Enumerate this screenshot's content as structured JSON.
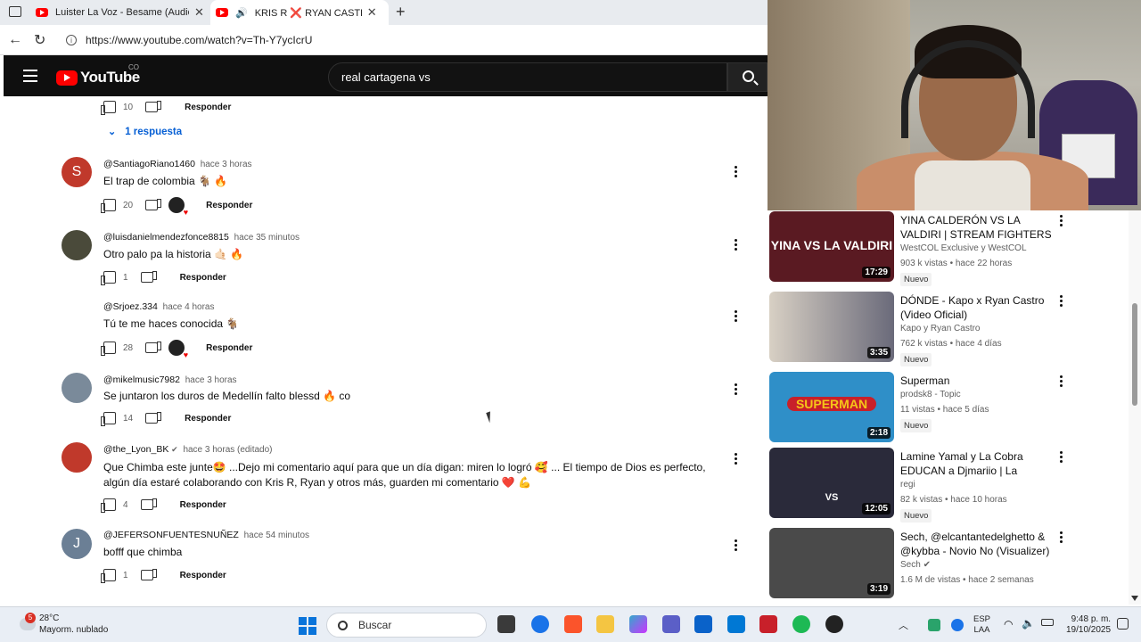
{
  "browser": {
    "tabs": [
      {
        "label": "Luister La Voz - Besame (Audio) |",
        "active": false
      },
      {
        "label": "KRIS R ❌ RYAN CASTRO - M",
        "active": true
      }
    ],
    "url": "https://www.youtube.com/watch?v=Th-Y7ycIcrU"
  },
  "youtube": {
    "logo_text": "YouTube",
    "country_code": "CO",
    "search_value": "real cartagena vs"
  },
  "comments": [
    {
      "id": "top-actions",
      "likes": "10",
      "reply_label": "Responder"
    },
    {
      "handle": "@SantiagoRiano1460",
      "time": "hace 3 horas",
      "text": "El trap de colombia 🐐 🔥",
      "likes": "20",
      "reply_label": "Responder",
      "avatar_letter": "S",
      "avatar_color": "#c0392b",
      "heart": true
    },
    {
      "handle": "@luisdanielmendezfonce8815",
      "time": "hace 35 minutos",
      "text": "Otro palo pa la historia 🤙🏻 🔥",
      "likes": "1",
      "reply_label": "Responder",
      "avatar_color": "#555",
      "heart": false
    },
    {
      "handle": "@Srjoez.334",
      "time": "hace 4 horas",
      "text": "Tú te me haces conocida 🐐",
      "likes": "28",
      "reply_label": "Responder",
      "heart": true
    },
    {
      "handle": "@mikelmusic7982",
      "time": "hace 3 horas",
      "text": "Se juntaron los duros de Medellín falto blessd 🔥 co",
      "likes": "14",
      "reply_label": "Responder",
      "avatar_color": "#7a8a9a",
      "heart": false
    },
    {
      "handle": "@the_Lyon_BK",
      "verified": "✔",
      "time": "hace 3 horas (editado)",
      "text": "Que Chimba este junte🤩 ...Dejo mi comentario aquí para que un día digan: miren lo logró 🥰 ... El tiempo de Dios es perfecto, algún día estaré colaborando con Kris R, Ryan y otros más, guarden mi comentario ❤️ 💪",
      "likes": "4",
      "reply_label": "Responder",
      "avatar_color": "#c0392b",
      "heart": false
    },
    {
      "handle": "@JEFERSONFUENTESNUÑEZ",
      "time": "hace 54 minutos",
      "text": "bofff que chimba",
      "likes": "1",
      "reply_label": "Responder",
      "avatar_letter": "J",
      "avatar_color": "#6b7f95",
      "heart": false
    }
  ],
  "replies_toggle": "1 respuesta",
  "recommendations": [
    {
      "title": "YINA CALDERÓN VS LA VALDIRI | STREAM FIGHTERS ...",
      "channel": "WestCOL Exclusive y WestCOL",
      "meta": "903 k vistas • hace 22 horas",
      "badge": "Nuevo",
      "duration": "17:29",
      "thumb_color": "#5a1a22",
      "thumb_text": "YINA VS LA VALDIRI"
    },
    {
      "title": "DÓNDE - Kapo x Ryan Castro (Video Oficial)",
      "channel": "Kapo y Ryan Castro",
      "meta": "762 k vistas • hace 4 días",
      "badge": "Nuevo",
      "duration": "3:35",
      "thumb_color": "#8a7a6a",
      "thumb_text": ""
    },
    {
      "title": "Superman",
      "channel": "prodsk8 - Topic",
      "meta": "11 vistas • hace 5 días",
      "badge": "Nuevo",
      "duration": "2:18",
      "thumb_color": "#2f8fc8",
      "thumb_text": "SUPERMAN"
    },
    {
      "title": "Lamine Yamal y La Cobra EDUCAN a Djmariio | La Capita...",
      "channel": "regi",
      "meta": "82 k vistas • hace 10 horas",
      "badge": "Nuevo",
      "duration": "12:05",
      "thumb_color": "#2a2a3a",
      "thumb_text": "VS"
    },
    {
      "title": "Sech, @elcantantedelghetto & @kybba - Novio No (Visualizer)",
      "channel": "Sech",
      "channel_verified": "✔",
      "meta": "1.6 M de vistas • hace 2 semanas",
      "badge": "",
      "duration": "3:19",
      "thumb_color": "#4a4a4a",
      "thumb_text": ""
    }
  ],
  "taskbar": {
    "weather_temp": "28°C",
    "weather_desc": "Mayorm. nublado",
    "weather_badge": "5",
    "search_placeholder": "Buscar",
    "lang_top": "ESP",
    "lang_bottom": "LAA",
    "time": "9:48 p. m.",
    "date": "19/10/2025"
  }
}
